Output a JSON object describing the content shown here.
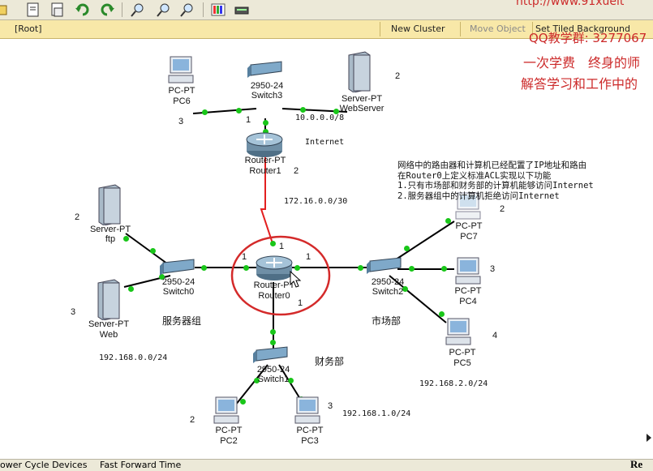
{
  "toolbar": {
    "icons": [
      "open-icon",
      "save-icon",
      "print-icon",
      "undo-icon",
      "redo-icon",
      "zoom-in-icon",
      "zoom-reset-icon",
      "zoom-out-icon",
      "palette-icon",
      "device-template-icon"
    ]
  },
  "nav": {
    "root": "[Root]",
    "new_cluster": "New Cluster",
    "move_object": "Move Object",
    "set_tiled_background": "Set Tiled Background"
  },
  "watermark": {
    "url": "http://www.91xueit",
    "qq": "QQ教学群: 3277067",
    "line1": "一次学费　终身的师",
    "line2": "解答学习和工作中的"
  },
  "devices": {
    "pc6": {
      "model": "PC-PT",
      "name": "PC6"
    },
    "switch3": {
      "model": "2950-24",
      "name": "Switch3"
    },
    "webserver": {
      "model": "Server-PT",
      "name": "WebServer"
    },
    "router1": {
      "model": "Router-PT",
      "name": "Router1"
    },
    "ftp": {
      "model": "Server-PT",
      "name": "ftp"
    },
    "web": {
      "model": "Server-PT",
      "name": "Web"
    },
    "switch0": {
      "model": "2950-24",
      "name": "Switch0"
    },
    "router0": {
      "model": "Router-PT",
      "name": "Router0"
    },
    "switch2": {
      "model": "2950-24",
      "name": "Switch2"
    },
    "pc7": {
      "model": "PC-PT",
      "name": "PC7"
    },
    "pc4": {
      "model": "PC-PT",
      "name": "PC4"
    },
    "pc5": {
      "model": "PC-PT",
      "name": "PC5"
    },
    "switch1": {
      "model": "2950-24",
      "name": "Switch1"
    },
    "pc2": {
      "model": "PC-PT",
      "name": "PC2"
    },
    "pc3": {
      "model": "PC-PT",
      "name": "PC3"
    }
  },
  "labels": {
    "internet": "Internet",
    "net_internet": "10.0.0.0/8",
    "net_link": "172.16.0.0/30",
    "net_server": "192.168.0.0/24",
    "net_market": "192.168.2.0/24",
    "net_finance": "192.168.1.0/24",
    "group_server": "服务器组",
    "group_market": "市场部",
    "group_finance": "财务部"
  },
  "numbers": {
    "pc6": "3",
    "webserver": "2",
    "r1_port": "1",
    "r1_right": "2",
    "ftp": "2",
    "web": "3",
    "pc7": "2",
    "pc4": "3",
    "pc5": "4",
    "pc2": "2",
    "pc3": "3",
    "r0_top": "1",
    "r0_left": "1",
    "r0_right": "1",
    "r0_bottom": "1"
  },
  "task": {
    "line1": "网络中的路由器和计算机已经配置了IP地址和路由",
    "line2": "在Router0上定义标准ACL实现以下功能",
    "line3": "1.只有市场部和财务部的计算机能够访问Internet",
    "line4": "2.服务器组中的计算机拒绝访问Internet"
  },
  "status": {
    "power_cycle": "ower Cycle Devices",
    "fast_forward": "Fast Forward Time",
    "right": "Re"
  },
  "colors": {
    "link": "#000000",
    "serial": "#e32020",
    "port_up": "#19c619",
    "highlight": "#d42a2a",
    "watermark": "#cc2a2a"
  }
}
